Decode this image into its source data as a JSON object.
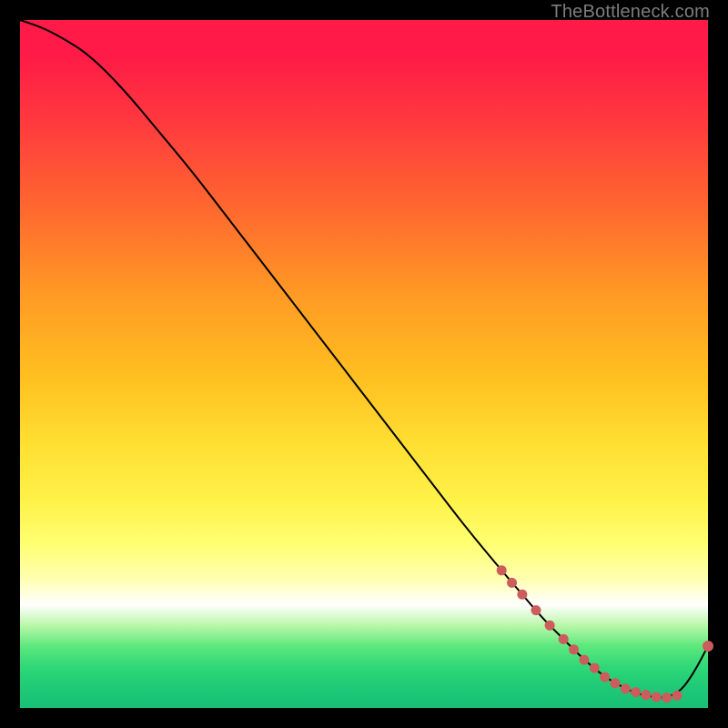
{
  "attribution": "TheBottleneck.com",
  "chart_data": {
    "type": "line",
    "title": "",
    "xlabel": "",
    "ylabel": "",
    "xlim": [
      0,
      100
    ],
    "ylim": [
      0,
      100
    ],
    "grid": false,
    "legend": false,
    "curve_color": "#000000",
    "marker_color": "#cd5c5c",
    "series": [
      {
        "name": "curve",
        "x": [
          0,
          3,
          6,
          10,
          15,
          20,
          25,
          30,
          35,
          40,
          45,
          50,
          55,
          60,
          65,
          70,
          73,
          76,
          79,
          82,
          85,
          88,
          90,
          92,
          94,
          96,
          98,
          100
        ],
        "y": [
          100,
          99,
          97.5,
          95,
          90,
          84,
          78,
          71.5,
          65,
          58.5,
          52,
          45.5,
          39,
          32.5,
          26,
          20,
          16.5,
          13,
          10,
          7,
          4.5,
          2.8,
          2,
          1.6,
          1.5,
          2.4,
          5.2,
          9
        ]
      }
    ],
    "markers": {
      "name": "highlighted-points",
      "x": [
        70,
        71.5,
        73,
        75,
        77,
        79,
        80.5,
        82,
        83.5,
        85,
        86.5,
        88,
        89.5,
        91,
        92.5,
        94,
        95.5,
        100
      ],
      "y": [
        20,
        18.2,
        16.5,
        14.2,
        12,
        10,
        8.5,
        7,
        5.8,
        4.5,
        3.6,
        2.8,
        2.3,
        1.9,
        1.6,
        1.5,
        1.8,
        9
      ]
    }
  }
}
